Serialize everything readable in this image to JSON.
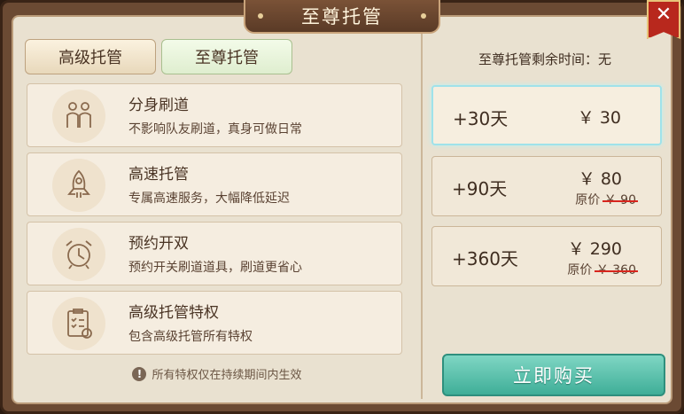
{
  "title": "至尊托管",
  "tabs": [
    {
      "label": "高级托管"
    },
    {
      "label": "至尊托管"
    }
  ],
  "features": [
    {
      "title": "分身刷道",
      "desc": "不影响队友刷道，真身可做日常",
      "icon": "two-people-icon"
    },
    {
      "title": "高速托管",
      "desc": "专属高速服务，大幅降低延迟",
      "icon": "rocket-icon"
    },
    {
      "title": "预约开双",
      "desc": "预约开关刷道道具，刷道更省心",
      "icon": "alarm-clock-icon"
    },
    {
      "title": "高级托管特权",
      "desc": "包含高级托管所有特权",
      "icon": "checklist-icon"
    }
  ],
  "note": "所有特权仅在持续期间内生效",
  "remaining": "至尊托管剩余时间：无",
  "plans": [
    {
      "days": "+30天",
      "price": "￥ 30",
      "selected": true
    },
    {
      "days": "+90天",
      "price": "￥ 80",
      "orig_label": "原价",
      "orig_price": "￥ 90"
    },
    {
      "days": "+360天",
      "price": "￥ 290",
      "orig_label": "原价",
      "orig_price": "￥ 360"
    }
  ],
  "buy_label": "立即购买",
  "colors": {
    "accent": "#3fae98",
    "frame": "#6b4a33",
    "close": "#b8281d",
    "strike": "#d8261e"
  }
}
